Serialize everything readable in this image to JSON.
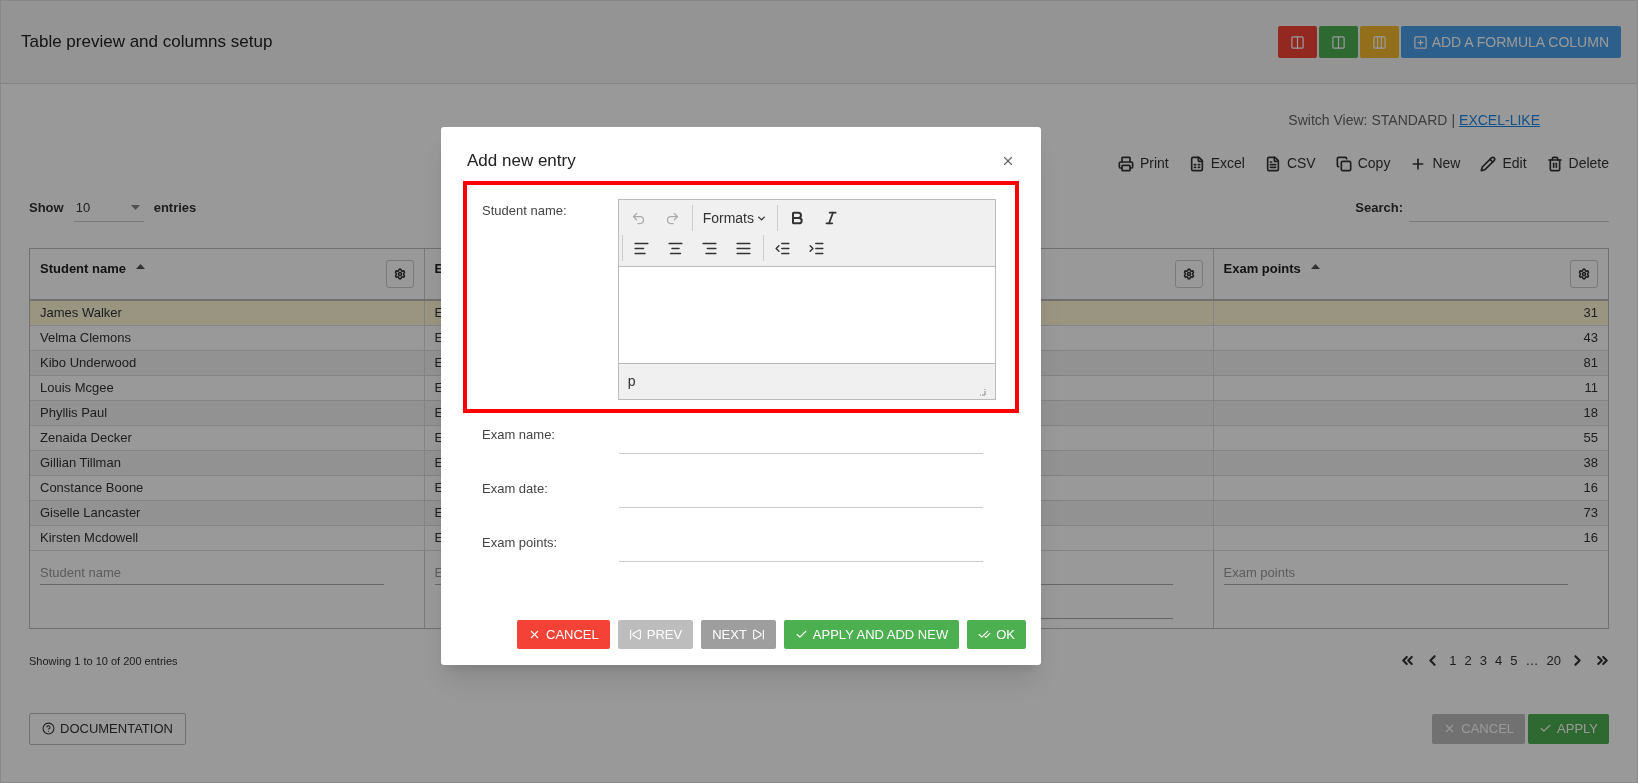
{
  "page": {
    "title": "Table preview and columns setup"
  },
  "header_buttons": [
    {
      "kind": "remove-column"
    },
    {
      "kind": "add-column"
    },
    {
      "kind": "columns"
    },
    {
      "kind": "formula",
      "label": "ADD A FORMULA COLUMN"
    }
  ],
  "switch_view": {
    "label": "Switch View:",
    "separator": "|",
    "options": [
      {
        "label": "STANDARD",
        "selected": true
      },
      {
        "label": "EXCEL-LIKE",
        "selected": false
      }
    ]
  },
  "toolbar": [
    {
      "kind": "print",
      "label": "Print"
    },
    {
      "kind": "excel",
      "label": "Excel"
    },
    {
      "kind": "csv",
      "label": "CSV"
    },
    {
      "kind": "copy",
      "label": "Copy"
    },
    {
      "kind": "new",
      "label": "New"
    },
    {
      "kind": "edit",
      "label": "Edit"
    },
    {
      "kind": "delete",
      "label": "Delete"
    }
  ],
  "length_menu": {
    "before": "Show",
    "value": "10",
    "after": "entries"
  },
  "search": {
    "label": "Search:"
  },
  "table": {
    "columns": [
      {
        "kind": "text",
        "header": "Student name",
        "filter_placeholder": "Student name"
      },
      {
        "kind": "covered",
        "header": "E",
        "filter_placeholder": "E"
      },
      {
        "kind": "range"
      },
      {
        "kind": "text",
        "header": "Exam points",
        "filter_placeholder": "Exam points"
      }
    ],
    "rows": [
      {
        "student_name": "James Walker",
        "exam_name": "E",
        "exam_points": "31",
        "selected": true
      },
      {
        "student_name": "Velma Clemons",
        "exam_name": "E",
        "exam_points": "43",
        "selected": false
      },
      {
        "student_name": "Kibo Underwood",
        "exam_name": "E",
        "exam_points": "81",
        "selected": false
      },
      {
        "student_name": "Louis Mcgee",
        "exam_name": "E",
        "exam_points": "11",
        "selected": false
      },
      {
        "student_name": "Phyllis Paul",
        "exam_name": "E",
        "exam_points": "18",
        "selected": false
      },
      {
        "student_name": "Zenaida Decker",
        "exam_name": "E",
        "exam_points": "55",
        "selected": false
      },
      {
        "student_name": "Gillian Tillman",
        "exam_name": "E",
        "exam_points": "38",
        "selected": false
      },
      {
        "student_name": "Constance Boone",
        "exam_name": "E",
        "exam_points": "16",
        "selected": false
      },
      {
        "student_name": "Giselle Lancaster",
        "exam_name": "E",
        "exam_points": "73",
        "selected": false
      },
      {
        "student_name": "Kirsten Mcdowell",
        "exam_name": "E",
        "exam_points": "16",
        "selected": false
      }
    ]
  },
  "info": "Showing 1 to 10 of 200 entries",
  "pagination": {
    "pages": [
      "1",
      "2",
      "3",
      "4",
      "5"
    ],
    "ellipsis": "…",
    "last": "20"
  },
  "footer": {
    "documentation": "DOCUMENTATION",
    "buttons": [
      {
        "kind": "cancel",
        "label": "CANCEL",
        "disabled": true
      },
      {
        "kind": "apply",
        "label": "APPLY",
        "disabled": false
      }
    ]
  },
  "dialog": {
    "title": "Add new entry",
    "fields": [
      {
        "kind": "rich-text",
        "label": "Student name:",
        "highlighted": true,
        "formats": "Formats",
        "path": "p"
      },
      {
        "kind": "text",
        "label": "Exam name:",
        "highlighted": false
      },
      {
        "kind": "text",
        "label": "Exam date:",
        "highlighted": false
      },
      {
        "kind": "text",
        "label": "Exam points:",
        "highlighted": false
      }
    ],
    "buttons": [
      {
        "kind": "cancel",
        "label": "CANCEL",
        "disabled": false
      },
      {
        "kind": "prev",
        "label": "PREV",
        "disabled": true
      },
      {
        "kind": "next",
        "label": "NEXT",
        "disabled": false
      },
      {
        "kind": "apply-new",
        "label": "APPLY AND ADD NEW",
        "disabled": false
      },
      {
        "kind": "ok",
        "label": "OK",
        "disabled": false
      }
    ]
  }
}
